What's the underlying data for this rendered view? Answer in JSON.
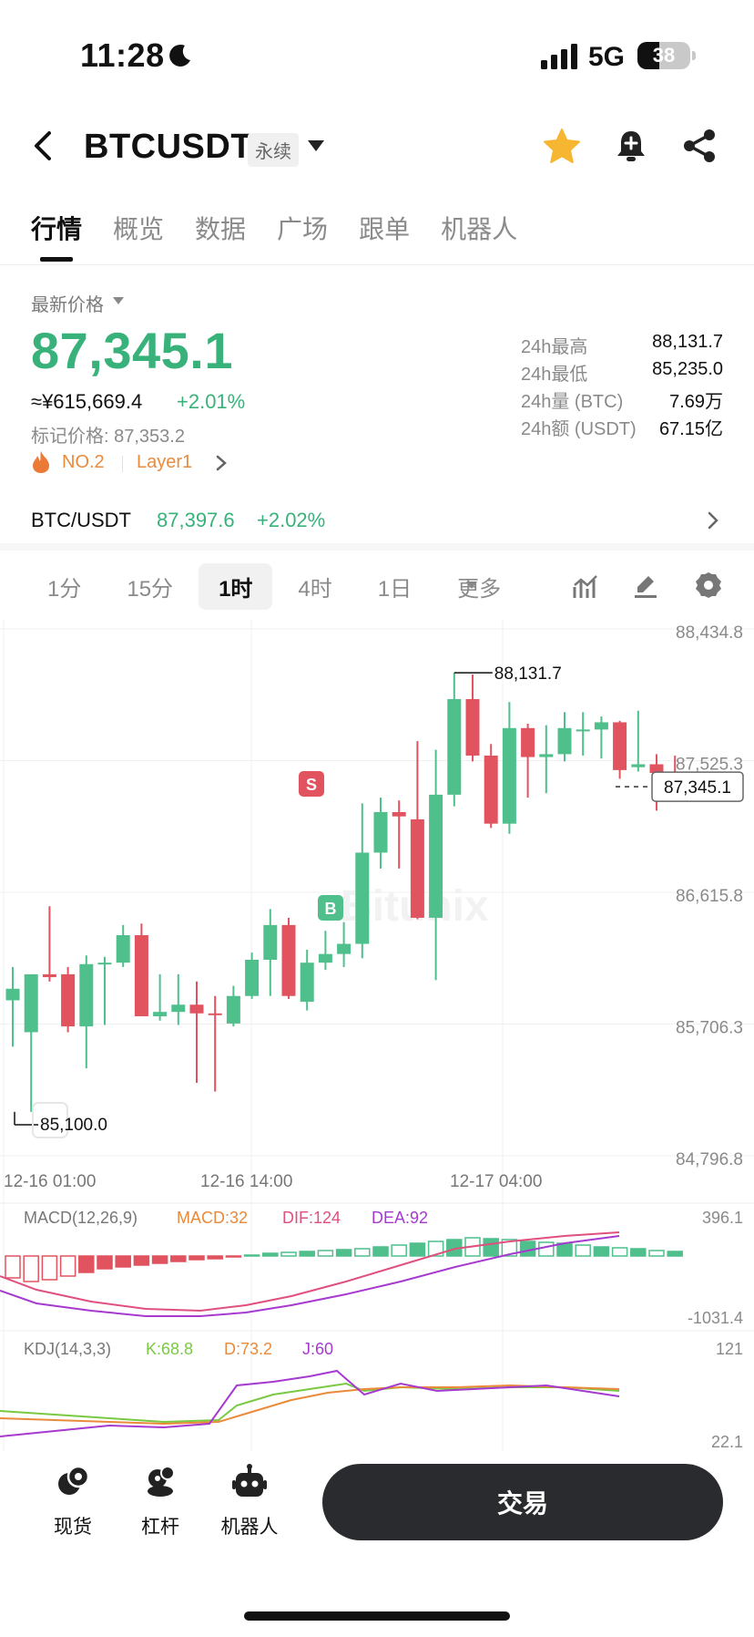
{
  "status_bar": {
    "time": "11:28",
    "network": "5G",
    "battery": "38"
  },
  "header": {
    "title": "BTCUSDT",
    "contract_tag": "永续"
  },
  "tabs": [
    {
      "label": "行情",
      "active": true
    },
    {
      "label": "概览"
    },
    {
      "label": "数据"
    },
    {
      "label": "广场"
    },
    {
      "label": "跟单"
    },
    {
      "label": "机器人"
    }
  ],
  "price": {
    "latest_label": "最新价格",
    "last": "87,345.1",
    "cny": "≈¥615,669.4",
    "change_pct": "+2.01%",
    "mark_price": "标记价格: 87,353.2",
    "rank": "NO.2",
    "sector": "Layer1"
  },
  "stats": [
    {
      "label": "24h最高",
      "value": "88,131.7"
    },
    {
      "label": "24h最低",
      "value": "85,235.0"
    },
    {
      "label": "24h量 (BTC)",
      "value": "7.69万"
    },
    {
      "label": "24h额 (USDT)",
      "value": "67.15亿"
    }
  ],
  "spot": {
    "pair": "BTC/USDT",
    "price": "87,397.6",
    "change_pct": "+2.02%"
  },
  "intervals": [
    {
      "label": "1分"
    },
    {
      "label": "15分"
    },
    {
      "label": "1时",
      "active": true
    },
    {
      "label": "4时"
    },
    {
      "label": "1日"
    },
    {
      "label": "更多"
    }
  ],
  "colors": {
    "up": "#4fbf8c",
    "down": "#e0535f",
    "accent_green": "#38b27a",
    "orange": "#ea8a3b",
    "button_dark": "#2a2b2e"
  },
  "chart_data": {
    "type": "candlestick",
    "y_axis_ticks": [
      "88,434.8",
      "87,525.3",
      "86,615.8",
      "85,706.3",
      "84,796.8"
    ],
    "ylim": [
      84796.8,
      88434.8
    ],
    "x_axis_ticks": [
      "12-16 01:00",
      "12-16 14:00",
      "12-17 04:00"
    ],
    "high_marker": "88,131.7",
    "low_marker": "85,100.0",
    "current_price_label": "87,345.1",
    "trade_markers": [
      "S",
      "B"
    ],
    "candles": [
      {
        "o": 85870,
        "h": 86100,
        "l": 85550,
        "c": 85950
      },
      {
        "o": 85650,
        "h": 86000,
        "l": 85100,
        "c": 86050
      },
      {
        "o": 86050,
        "h": 86520,
        "l": 86000,
        "c": 86030
      },
      {
        "o": 86050,
        "h": 86100,
        "l": 85650,
        "c": 85690
      },
      {
        "o": 85690,
        "h": 86180,
        "l": 85400,
        "c": 86120
      },
      {
        "o": 86120,
        "h": 86170,
        "l": 85700,
        "c": 86130
      },
      {
        "o": 86130,
        "h": 86390,
        "l": 86100,
        "c": 86320
      },
      {
        "o": 86320,
        "h": 86400,
        "l": 85770,
        "c": 85760
      },
      {
        "o": 85760,
        "h": 86050,
        "l": 85730,
        "c": 85790
      },
      {
        "o": 85790,
        "h": 86050,
        "l": 85700,
        "c": 85840
      },
      {
        "o": 85840,
        "h": 86000,
        "l": 85300,
        "c": 85780
      },
      {
        "o": 85780,
        "h": 85900,
        "l": 85240,
        "c": 85770
      },
      {
        "o": 85710,
        "h": 85970,
        "l": 85690,
        "c": 85900
      },
      {
        "o": 85900,
        "h": 86200,
        "l": 85880,
        "c": 86150
      },
      {
        "o": 86150,
        "h": 86500,
        "l": 85900,
        "c": 86390
      },
      {
        "o": 86390,
        "h": 86440,
        "l": 85880,
        "c": 85900
      },
      {
        "o": 85860,
        "h": 86220,
        "l": 85800,
        "c": 86130
      },
      {
        "o": 86130,
        "h": 86350,
        "l": 86080,
        "c": 86190
      },
      {
        "o": 86190,
        "h": 86410,
        "l": 86100,
        "c": 86260
      },
      {
        "o": 86260,
        "h": 87230,
        "l": 86160,
        "c": 86890
      },
      {
        "o": 86890,
        "h": 87270,
        "l": 86780,
        "c": 87170
      },
      {
        "o": 87170,
        "h": 87250,
        "l": 86780,
        "c": 87140
      },
      {
        "o": 87120,
        "h": 87660,
        "l": 86430,
        "c": 86440
      },
      {
        "o": 86440,
        "h": 87600,
        "l": 86010,
        "c": 87290
      },
      {
        "o": 87290,
        "h": 88131.7,
        "l": 87210,
        "c": 87950
      },
      {
        "o": 87950,
        "h": 88120,
        "l": 87520,
        "c": 87560
      },
      {
        "o": 87560,
        "h": 87640,
        "l": 87060,
        "c": 87090
      },
      {
        "o": 87090,
        "h": 87930,
        "l": 87020,
        "c": 87750
      },
      {
        "o": 87750,
        "h": 87780,
        "l": 87270,
        "c": 87550
      },
      {
        "o": 87550,
        "h": 87770,
        "l": 87300,
        "c": 87570
      },
      {
        "o": 87570,
        "h": 87860,
        "l": 87520,
        "c": 87750
      },
      {
        "o": 87730,
        "h": 87860,
        "l": 87560,
        "c": 87740
      },
      {
        "o": 87740,
        "h": 87830,
        "l": 87540,
        "c": 87790
      },
      {
        "o": 87790,
        "h": 87800,
        "l": 87400,
        "c": 87460
      },
      {
        "o": 87480,
        "h": 87870,
        "l": 87450,
        "c": 87500
      },
      {
        "o": 87500,
        "h": 87570,
        "l": 87180,
        "c": 87440
      },
      {
        "o": 87440,
        "h": 87560,
        "l": 87300,
        "c": 87345.1
      }
    ],
    "macd": {
      "label": "MACD(12,26,9)",
      "macd": "MACD:32",
      "dif": "DIF:124",
      "dea": "DEA:92",
      "axis_top": "396.1",
      "axis_bottom": "-1031.4"
    },
    "kdj": {
      "label": "KDJ(14,3,3)",
      "k": "K:68.8",
      "d": "D:73.2",
      "j": "J:60",
      "axis_top": "121",
      "axis_bottom": "22.1"
    }
  },
  "bottom_nav": [
    {
      "label": "现货"
    },
    {
      "label": "杠杆"
    },
    {
      "label": "机器人"
    }
  ],
  "trade_button": "交易"
}
